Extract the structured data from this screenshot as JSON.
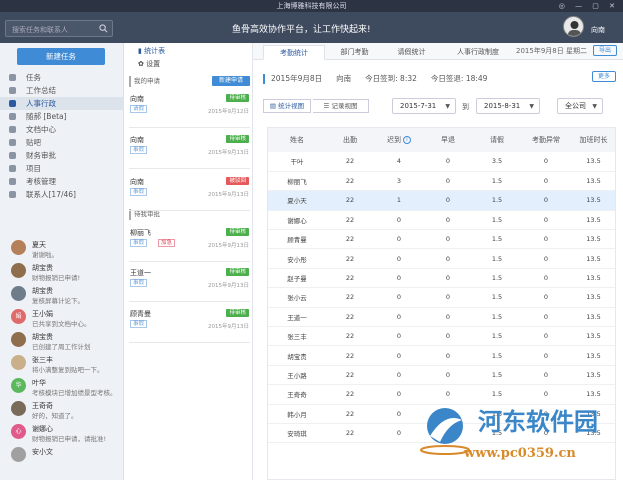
{
  "window": {
    "title": "上海博雅科技有限公司"
  },
  "top": {
    "search_placeholder": "搜索任务和联系人",
    "slogan": "鱼骨高效协作平台，让工作快起来!",
    "user": "向南"
  },
  "sidebar": {
    "new_task": "新建任务",
    "menu": [
      "任务",
      "工作总结",
      "人事行政",
      "随郝 [Beta]",
      "文档中心",
      "贴吧",
      "财务审批",
      "项目",
      "考核管理",
      "联系人[17/46]"
    ],
    "active_index": 2,
    "contacts": [
      {
        "name": "夏天",
        "msg": "谢谢啦。",
        "color": "#b57f5a"
      },
      {
        "name": "胡宝贵",
        "msg": "财物报销已申请!",
        "color": "#8f6e4e"
      },
      {
        "name": "胡宝贵",
        "msg": "复核屏幕计论下。",
        "color": "#6f7c8a"
      },
      {
        "name": "王小娟",
        "msg": "已共享到文档中心。",
        "color": "#e06a6a",
        "initial": "娟"
      },
      {
        "name": "胡宝贵",
        "msg": "已创建了周工作计划",
        "color": "#8f6e4e"
      },
      {
        "name": "张三丰",
        "msg": "将小满整复到贴吧一下。",
        "color": "#c9b08a"
      },
      {
        "name": "叶华",
        "msg": "考核模块已增加绩景型考核。",
        "color": "#5cb85c",
        "initial": "华"
      },
      {
        "name": "王奇奇",
        "msg": "好的，知道了。",
        "color": "#7a6a5a"
      },
      {
        "name": "谢娜心",
        "msg": "财物报销已申请，请批准!",
        "color": "#e05a8a",
        "initial": "心"
      },
      {
        "name": "安小文",
        "msg": "",
        "color": "#a0a0a0"
      }
    ]
  },
  "mid": {
    "tab_stats": "统计表",
    "tab_settings": "设置",
    "section_mine": "我的申请",
    "new_request": "新建申请",
    "section_pending": "待我审批",
    "cards": [
      {
        "name": "向南",
        "tag": "请假",
        "tag2": "",
        "status": "待审核",
        "status_red": false,
        "date": "2015年9月12日"
      },
      {
        "name": "向南",
        "tag": "事假",
        "tag2": "",
        "status": "待审核",
        "status_red": false,
        "date": "2015年9月13日"
      },
      {
        "name": "向南",
        "tag": "事假",
        "tag2": "",
        "status": "被驳回",
        "status_red": true,
        "date": "2015年9月13日"
      },
      {
        "name": "柳丽飞",
        "tag": "事假",
        "tag2": "加急",
        "status": "待审核",
        "status_red": false,
        "date": "2015年9月13日"
      },
      {
        "name": "王道一",
        "tag": "事假",
        "tag2": "",
        "status": "待审核",
        "status_red": false,
        "date": "2015年9月13日"
      },
      {
        "name": "顾青曼",
        "tag": "事假",
        "tag2": "",
        "status": "待审核",
        "status_red": false,
        "date": "2015年9月13日"
      }
    ]
  },
  "main": {
    "tabs": [
      "考勤统计",
      "部门考勤",
      "请假统计",
      "人事行政制度"
    ],
    "active_tab": 0,
    "date_label": "2015年9月8日  星期二",
    "export": "导出",
    "info": {
      "date": "2015年9月8日",
      "user": "向南",
      "checkin": "今日签到:  8:32",
      "checkout": "今日签退:  18:49"
    },
    "more": "更多",
    "view_stats": "统计视图",
    "view_records": "记录视图",
    "date_from": "2015-7-31",
    "to_label": "到",
    "date_to": "2015-8-31",
    "company": "全公司",
    "headers": [
      "姓名",
      "出勤",
      "迟到",
      "早退",
      "请假",
      "考勤异常",
      "加班时长"
    ],
    "rows": [
      [
        "干叶",
        "22",
        "4",
        "0",
        "3.5",
        "0",
        "13.5"
      ],
      [
        "柳丽飞",
        "22",
        "3",
        "0",
        "1.5",
        "0",
        "13.5"
      ],
      [
        "夏小天",
        "22",
        "1",
        "0",
        "1.5",
        "0",
        "13.5"
      ],
      [
        "谢娜心",
        "22",
        "0",
        "0",
        "1.5",
        "0",
        "13.5"
      ],
      [
        "顾青曼",
        "22",
        "0",
        "0",
        "1.5",
        "0",
        "13.5"
      ],
      [
        "安小彤",
        "22",
        "0",
        "0",
        "1.5",
        "0",
        "13.5"
      ],
      [
        "赵子曼",
        "22",
        "0",
        "0",
        "1.5",
        "0",
        "13.5"
      ],
      [
        "张小云",
        "22",
        "0",
        "0",
        "1.5",
        "0",
        "13.5"
      ],
      [
        "王道一",
        "22",
        "0",
        "0",
        "1.5",
        "0",
        "13.5"
      ],
      [
        "张三丰",
        "22",
        "0",
        "0",
        "1.5",
        "0",
        "13.5"
      ],
      [
        "胡宝贵",
        "22",
        "0",
        "0",
        "1.5",
        "0",
        "13.5"
      ],
      [
        "王小路",
        "22",
        "0",
        "0",
        "1.5",
        "0",
        "13.5"
      ],
      [
        "王奇奇",
        "22",
        "0",
        "0",
        "1.5",
        "0",
        "13.5"
      ],
      [
        "韩小月",
        "22",
        "0",
        "0",
        "1.5",
        "0",
        "13.5"
      ],
      [
        "安琦琪",
        "22",
        "0",
        "0",
        "1.5",
        "0",
        "13.5"
      ]
    ],
    "highlight_row": 2
  },
  "watermark": {
    "line1": "河东软件园",
    "line2": "www.pc0359.cn"
  }
}
